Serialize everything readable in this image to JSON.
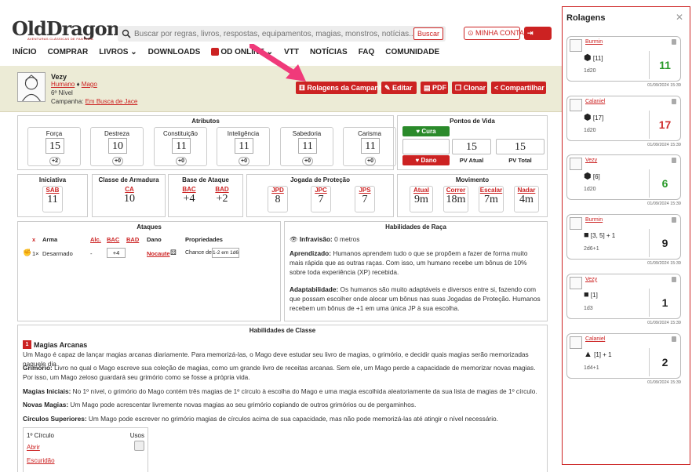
{
  "header": {
    "logo": "OldDragon",
    "logo_sub": "AVENTURAS CLÁSSICAS DE FANTASIA",
    "search_placeholder": "Buscar por regras, livros, respostas, equipamentos, magias, monstros, notícias...",
    "search_btn": "Buscar",
    "account": "MINHA CONTA",
    "logout": "SAIR"
  },
  "nav": [
    "INÍCIO",
    "COMPRAR",
    "LIVROS",
    "DOWNLOADS",
    "OD ONLINE",
    "VTT",
    "NOTÍCIAS",
    "FAQ",
    "COMUNIDADE"
  ],
  "character": {
    "name": "Vezy",
    "race": "Humano",
    "cls": "Mago",
    "level": "6º Nível",
    "campaign_label": "Campanha:",
    "campaign": "Em Busca de Jace"
  },
  "actions": [
    "Rolagens da Campanha",
    "Editar",
    "PDF",
    "Clonar",
    "Compartilhar"
  ],
  "attributes": {
    "title": "Atributos",
    "items": [
      {
        "name": "Força",
        "value": "15",
        "mod": "+2"
      },
      {
        "name": "Destreza",
        "value": "10",
        "mod": "+0"
      },
      {
        "name": "Constituição",
        "value": "11",
        "mod": "+0"
      },
      {
        "name": "Inteligência",
        "value": "11",
        "mod": "+0"
      },
      {
        "name": "Sabedoria",
        "value": "11",
        "mod": "+0"
      },
      {
        "name": "Carisma",
        "value": "11",
        "mod": "+0"
      }
    ]
  },
  "hp": {
    "title": "Pontos de Vida",
    "heal": "Cura",
    "damage": "Dano",
    "current": "15",
    "total": "15",
    "current_label": "PV Atual",
    "total_label": "PV Total"
  },
  "initiative": {
    "title": "Iniciativa",
    "label": "SAB",
    "value": "11"
  },
  "armor": {
    "title": "Classe de Armadura",
    "label": "CA",
    "value": "10"
  },
  "attack": {
    "title": "Base de Ataque",
    "items": [
      {
        "label": "BAC",
        "value": "+4"
      },
      {
        "label": "BAD",
        "value": "+2"
      }
    ]
  },
  "saves": {
    "title": "Jogada de Proteção",
    "items": [
      {
        "label": "JPD",
        "value": "8"
      },
      {
        "label": "JPC",
        "value": "7"
      },
      {
        "label": "JPS",
        "value": "7"
      }
    ]
  },
  "movement": {
    "title": "Movimento",
    "items": [
      {
        "label": "Atual",
        "value": "9m"
      },
      {
        "label": "Correr",
        "value": "18m"
      },
      {
        "label": "Escalar",
        "value": "7m"
      },
      {
        "label": "Nadar",
        "value": "4m"
      }
    ]
  },
  "attacks": {
    "title": "Ataques",
    "cols": [
      "x",
      "Arma",
      "Alc.",
      "BAC",
      "BAD",
      "Dano",
      "Propriedades"
    ],
    "row": {
      "qty": "1×",
      "weapon": "Desarmado",
      "reach": "-",
      "bac": "+4",
      "dmg": "Nocaute",
      "prop_label": "Chance de",
      "prop": "1-2 em 1d6"
    }
  },
  "race": {
    "title": "Habilidades de Raça",
    "infra_label": "Infravisão:",
    "infra": "0 metros",
    "p1_b": "Aprendizado:",
    "p1": "Humanos aprendem tudo o que se propõem a fazer de forma muito mais rápida que as outras raças. Com isso, um humano recebe um bônus de 10% sobre toda experiência (XP) recebida.",
    "p2_b": "Adaptabilidade:",
    "p2": "Os humanos são muito adaptáveis e diversos entre si, fazendo com que possam escolher onde alocar um bônus nas suas Jogadas de Proteção. Humanos recebem um bônus de +1 em uma única JP à sua escolha."
  },
  "classes": {
    "title": "Habilidades de Classe",
    "num": "1",
    "heading": "Magias Arcanas",
    "p0": "Um Mago é capaz de lançar magias arcanas diariamente. Para memorizá-las, o Mago deve estudar seu livro de magias, o grimório, e decidir quais magias serão memorizadas naquele dia.",
    "p1_b": "Grimório:",
    "p1": "Livro no qual o Mago escreve sua coleção de magias, como um grande livro de receitas arcanas. Sem ele, um Mago perde a capacidade de memorizar novas magias. Por isso, um Mago zeloso guardará seu grimório como se fosse a própria vida.",
    "p2_b": "Magias Iniciais:",
    "p2": "No 1º nível, o grimório do Mago contém três magias de 1º círculo à escolha do Mago e uma magia escolhida aleatoriamente da sua lista de magias de 1º círculo.",
    "p3_b": "Novas Magias:",
    "p3": "Um Mago pode acrescentar livremente novas magias ao seu grimório copiando de outros grimórios ou de pergaminhos.",
    "p4_b": "Círculos Superiores:",
    "p4": "Um Mago pode escrever no grimório magias de círculos acima de sua capacidade, mas não pode memorizá-las até atingir o nível necessário.",
    "circle": "1º Círculo",
    "uses": "Usos",
    "spell1": "Abrir",
    "spell2": "Escuridão"
  },
  "rolls": {
    "title": "Rolagens",
    "items": [
      {
        "user": "Burmin",
        "dice": "[11]",
        "formula": "1d20",
        "result": "11",
        "color": "#2a9a2a",
        "date": "01/09/2024 15:39"
      },
      {
        "user": "Calaniel",
        "dice": "[17]",
        "formula": "1d20",
        "result": "17",
        "color": "#d03030",
        "date": "01/09/2024 15:39"
      },
      {
        "user": "Vezy",
        "dice": "[6]",
        "formula": "1d20",
        "result": "6",
        "color": "#2a9a2a",
        "date": "01/09/2024 15:39"
      },
      {
        "user": "Burmin",
        "dice": "[3, 5] + 1",
        "formula": "2d6+1",
        "result": "9",
        "color": "#222222",
        "date": "01/09/2024 15:39"
      },
      {
        "user": "Vezy",
        "dice": "[1]",
        "formula": "1d3",
        "result": "1",
        "color": "#222222",
        "date": "01/09/2024 15:39"
      },
      {
        "user": "Calaniel",
        "dice": "[1] + 1",
        "formula": "1d4+1",
        "result": "2",
        "color": "#222222",
        "date": "01/09/2024 15:39"
      }
    ]
  }
}
